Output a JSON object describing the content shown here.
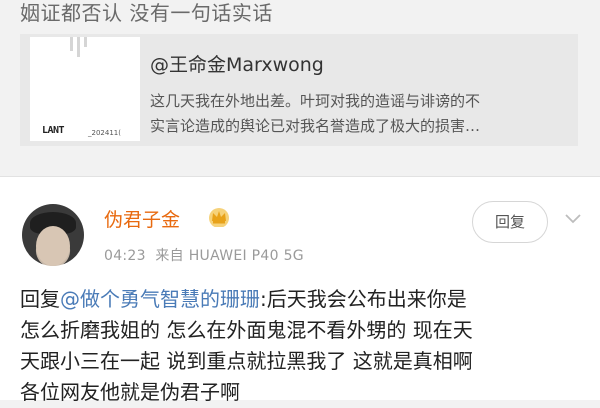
{
  "top_text": "姻证都否认 没有一句话实话",
  "card": {
    "title": "@王命金Marxwong",
    "desc_line1": "这几天我在外地出差。叶珂对我的造谣与诽谤的不",
    "desc_line2": "实言论造成的舆论已对我名誉造成了极大的损害…",
    "thumb_logo": "LANT",
    "thumb_date": "_202411("
  },
  "comment": {
    "username": "伪君子金",
    "time": "04:23",
    "source": "来自 HUAWEI P40 5G",
    "reply_button": "回复",
    "body": {
      "prefix": "回复",
      "mention": "@做个勇气智慧的珊珊",
      "line1_rest": ":后天我会公布出来你是",
      "line2": "怎么折磨我姐的 怎么在外面鬼混不看外甥的  现在天",
      "line3": "天跟小三在一起 说到重点就拉黑我了 这就是真相啊",
      "line4": "各位网友他就是伪君子啊"
    }
  },
  "icons": {
    "crown": "crown-icon",
    "chevron": "chevron-down-icon"
  },
  "colors": {
    "background": "#f2f2f2",
    "username": "#e86a10",
    "mention": "#4a7bb7",
    "meta": "#9a9a9a"
  }
}
